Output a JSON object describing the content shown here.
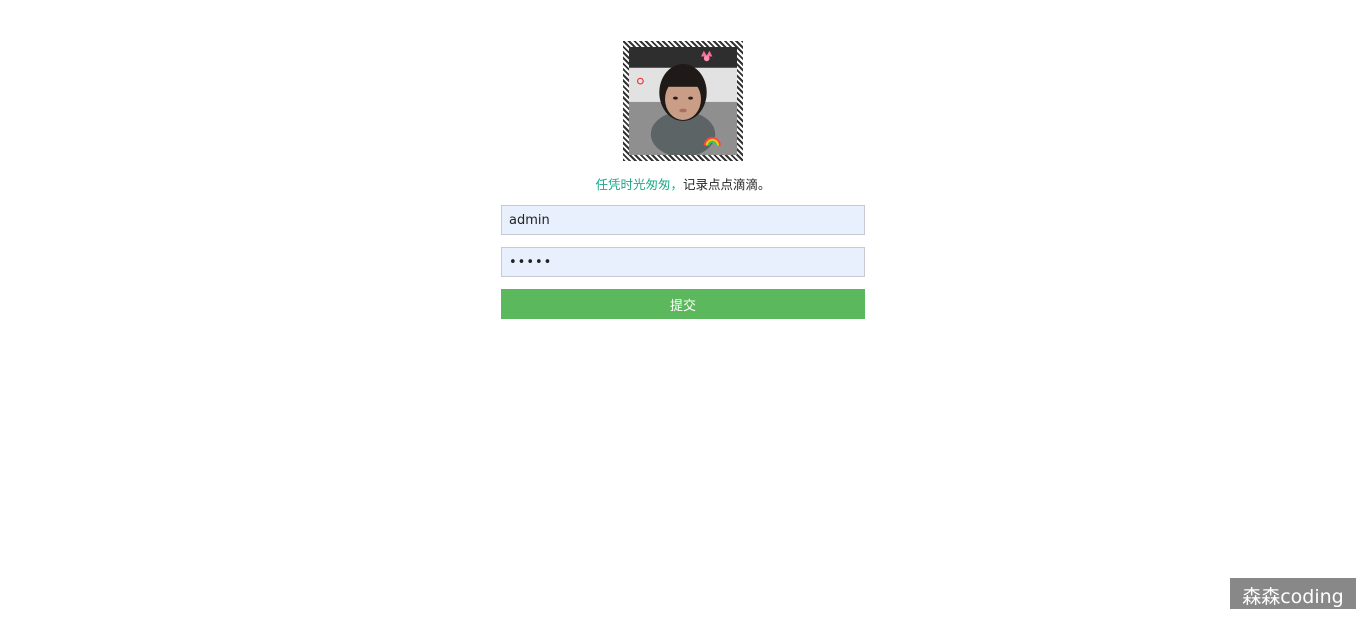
{
  "login": {
    "slogan_highlight": "任凭时光匆匆，",
    "slogan_rest": "记录点点滴滴。",
    "username_value": "admin",
    "password_value": "•••••",
    "submit_label": "提交"
  },
  "watermark": {
    "text": "森森coding"
  },
  "colors": {
    "accent": "#1aab8a",
    "button": "#5cb85c",
    "input_bg": "#e8effd"
  }
}
